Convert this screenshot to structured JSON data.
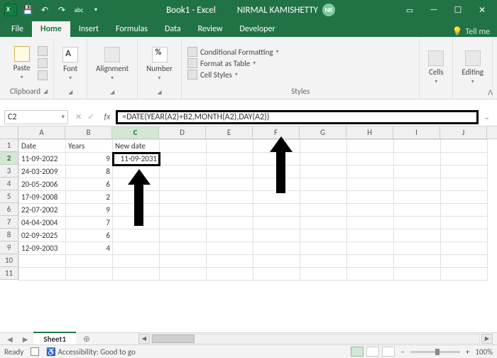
{
  "title": {
    "doc": "Book1 - Excel",
    "user": "NIRMAL KAMISHETTY",
    "initials": "NK"
  },
  "qat_icons": [
    "excel",
    "save",
    "undo",
    "redo",
    "spellcheck",
    "more"
  ],
  "tabs": [
    "File",
    "Home",
    "Insert",
    "Formulas",
    "Data",
    "Review",
    "Developer"
  ],
  "active_tab": "Home",
  "tell_me": "Tell me",
  "ribbon": {
    "clipboard": {
      "label": "Clipboard",
      "paste": "Paste"
    },
    "font": {
      "label": "Font"
    },
    "alignment": {
      "label": "Alignment"
    },
    "number": {
      "label": "Number"
    },
    "styles": {
      "label": "Styles",
      "cf": "Conditional Formatting",
      "fat": "Format as Table",
      "cs": "Cell Styles"
    },
    "cells": {
      "label": "Cells"
    },
    "editing": {
      "label": "Editing"
    }
  },
  "name_box": "C2",
  "formula": "=DATE(YEAR(A2)+B2,MONTH(A2),DAY(A2))",
  "columns": [
    "A",
    "B",
    "C",
    "D",
    "E",
    "F",
    "G",
    "H",
    "I",
    "J"
  ],
  "selected_col": "C",
  "selected_row": 2,
  "row_count": 11,
  "headers": {
    "A": "Date",
    "B": "Years",
    "C": "New date"
  },
  "chart_data": {
    "type": "table",
    "columns": [
      "Date",
      "Years",
      "New date"
    ],
    "rows": [
      [
        "11-09-2022",
        9,
        "11-09-2031"
      ],
      [
        "24-03-2009",
        8,
        ""
      ],
      [
        "20-05-2006",
        6,
        ""
      ],
      [
        "17-09-2008",
        2,
        ""
      ],
      [
        "22-07-2002",
        9,
        ""
      ],
      [
        "04-04-2004",
        7,
        ""
      ],
      [
        "02-09-2025",
        6,
        ""
      ],
      [
        "12-09-2003",
        4,
        ""
      ]
    ]
  },
  "sheet_tab": "Sheet1",
  "status": {
    "ready": "Ready",
    "access": "Accessibility: Good to go",
    "zoom": "100%"
  }
}
